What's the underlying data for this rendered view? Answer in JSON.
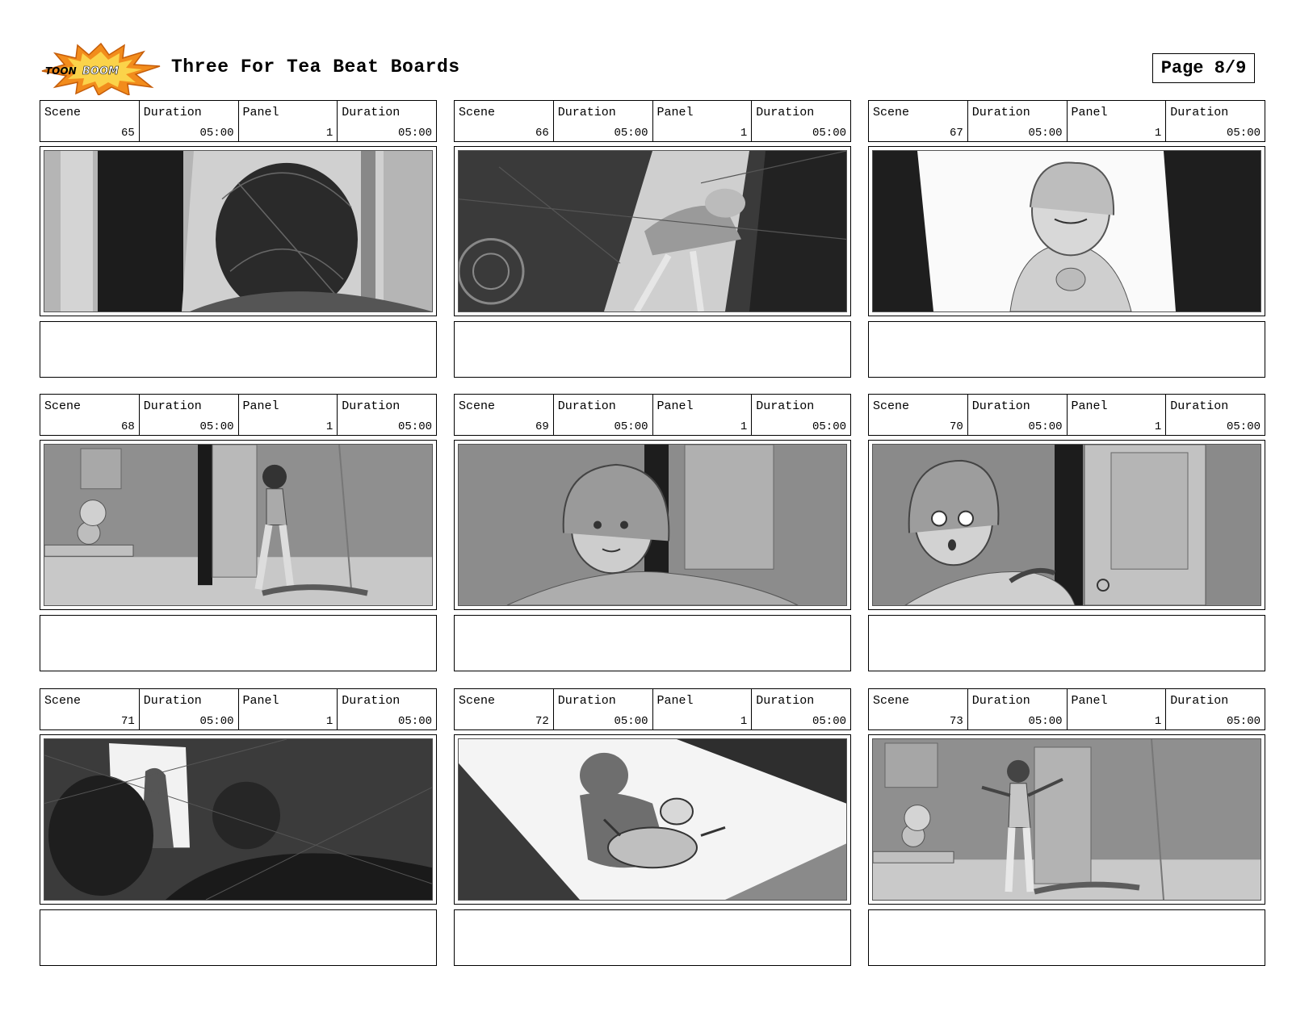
{
  "logo": {
    "text_top": "TOON",
    "text_bottom": "BOOM",
    "burst_color": "#f28c1c",
    "burst_inner": "#fbd34a"
  },
  "header": {
    "title": "Three For Tea Beat Boards",
    "page_label": "Page 8/9"
  },
  "labels": {
    "scene": "Scene",
    "duration": "Duration",
    "panel": "Panel",
    "panel_duration": "Duration"
  },
  "panels": [
    {
      "scene": "65",
      "duration": "05:00",
      "panel": "1",
      "panel_duration": "05:00",
      "notes": ""
    },
    {
      "scene": "66",
      "duration": "05:00",
      "panel": "1",
      "panel_duration": "05:00",
      "notes": ""
    },
    {
      "scene": "67",
      "duration": "05:00",
      "panel": "1",
      "panel_duration": "05:00",
      "notes": ""
    },
    {
      "scene": "68",
      "duration": "05:00",
      "panel": "1",
      "panel_duration": "05:00",
      "notes": ""
    },
    {
      "scene": "69",
      "duration": "05:00",
      "panel": "1",
      "panel_duration": "05:00",
      "notes": ""
    },
    {
      "scene": "70",
      "duration": "05:00",
      "panel": "1",
      "panel_duration": "05:00",
      "notes": ""
    },
    {
      "scene": "71",
      "duration": "05:00",
      "panel": "1",
      "panel_duration": "05:00",
      "notes": ""
    },
    {
      "scene": "72",
      "duration": "05:00",
      "panel": "1",
      "panel_duration": "05:00",
      "notes": ""
    },
    {
      "scene": "73",
      "duration": "05:00",
      "panel": "1",
      "panel_duration": "05:00",
      "notes": ""
    }
  ]
}
